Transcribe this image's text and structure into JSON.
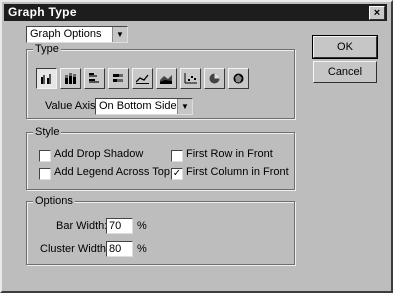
{
  "window": {
    "title": "Graph Type",
    "close_glyph": "×"
  },
  "options_select": {
    "value": "Graph Options"
  },
  "type_group": {
    "legend": "Type",
    "buttons": [
      {
        "icon": "grouped-column-chart-icon",
        "selected": true
      },
      {
        "icon": "stacked-column-chart-icon",
        "selected": false
      },
      {
        "icon": "grouped-bar-chart-icon",
        "selected": false
      },
      {
        "icon": "stacked-bar-chart-icon",
        "selected": false
      },
      {
        "icon": "line-chart-icon",
        "selected": false
      },
      {
        "icon": "area-chart-icon",
        "selected": false
      },
      {
        "icon": "scatter-chart-icon",
        "selected": false
      },
      {
        "icon": "pie-chart-icon",
        "selected": false
      },
      {
        "icon": "radar-chart-icon",
        "selected": false
      }
    ],
    "value_axis_label": "Value Axis:",
    "value_axis_value": "On Bottom Side"
  },
  "style_group": {
    "legend": "Style",
    "add_drop_shadow": {
      "label": "Add Drop Shadow",
      "checked": false
    },
    "add_legend_across_top": {
      "label": "Add Legend Across Top",
      "checked": false
    },
    "first_row_in_front": {
      "label": "First Row in Front",
      "checked": false
    },
    "first_column_in_front": {
      "label": "First Column in Front",
      "checked": true
    }
  },
  "options_group": {
    "legend": "Options",
    "bar_width_label": "Bar Width:",
    "bar_width_value": "70",
    "bar_width_unit": "%",
    "cluster_width_label": "Cluster Width:",
    "cluster_width_value": "80",
    "cluster_width_unit": "%"
  },
  "buttons": {
    "ok": "OK",
    "cancel": "Cancel"
  }
}
